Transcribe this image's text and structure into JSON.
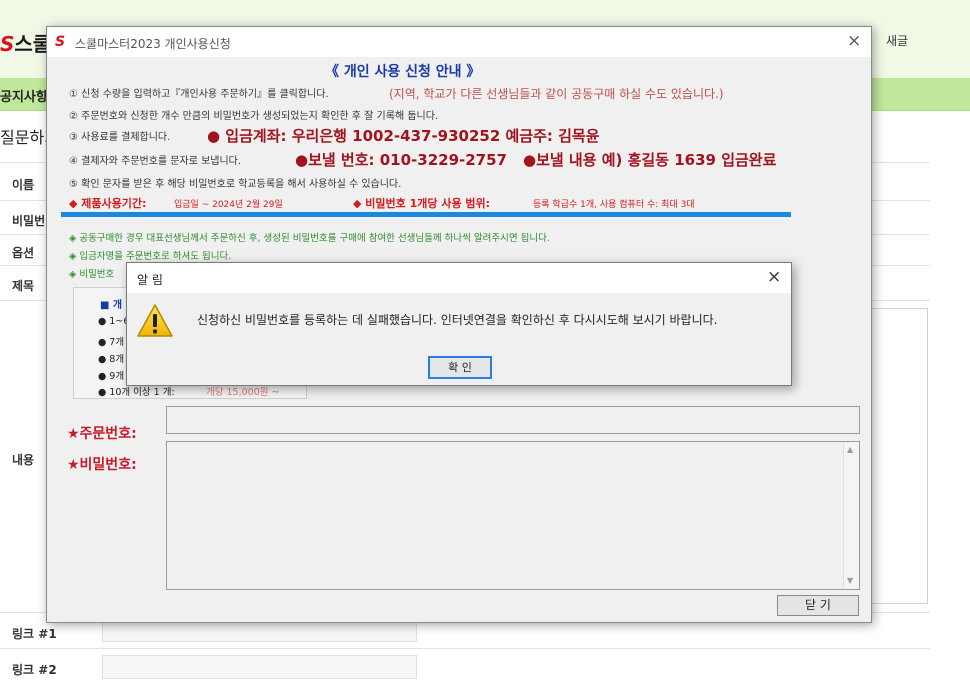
{
  "background": {
    "logo_s": "S",
    "logo_text": "스쿨",
    "new_post": "새글",
    "nav_notice": "공지사항",
    "page_title": "질문하기",
    "labels": {
      "name": "이름",
      "password": "비밀번",
      "option": "옵션",
      "subject": "제목",
      "content": "내용",
      "link1": "링크 #1",
      "link2": "링크 #2"
    }
  },
  "dialog": {
    "icon": "S",
    "title": "스쿨마스터2023 개인사용신청",
    "close": "×",
    "guide_title": "《 개인 사용 신청 안내 》",
    "steps": [
      "① 신청 수량을 입력하고『개인사용 주문하기』를 클릭합니다.",
      "② 주문번호와 신청한 개수 만큼의 비밀번호가 생성되었는지 확인한 후 잘 기록해 둡니다.",
      "③ 사용료를 결제합니다.",
      "④ 결제자와 주문번호를 문자로 보냅니다.",
      "⑤ 확인 문자를 받은 후 해당 비밀번호로 학교등록을 해서 사용하실 수 있습니다."
    ],
    "step_note": "(지역, 학교가 다른 선생님들과 같이 공동구매 하실 수도 있습니다.)",
    "bank_info": "● 입금계좌: 우리은행 1002-437-930252  예금주: 김목윤",
    "send_number": "●보낼 번호: 010-3229-2757",
    "send_content": "●보낼 내용 예) 홍길동 1639 입금완료",
    "period_label": "◆ 제품사용기간:",
    "period_value": "입금일 ~ 2024년 2월 29일",
    "scope_label": "◆ 비밀번호 1개당 사용 범위:",
    "scope_value": "등록 학급수 1개, 사용 컴퓨터 수: 최대 3대",
    "green_notes": [
      "◈ 공동구매한 경우 대표선생님께서 주문하신 후, 생성된 비밀번호를 구매에 참여한 선생님들께 하나씩 알려주시면 됩니다.",
      "◈ 입금자명을 주문번호로 하셔도 됩니다.",
      "◈ 비밀번호"
    ],
    "price_title": "■ 개",
    "price_items": [
      "● 1~6",
      "● 7개",
      "● 8개",
      "● 9개",
      "● 10개 이상 1 개:"
    ],
    "price_tail": "개당 15,000원 ~",
    "order_label": "★주문번호:",
    "password_label": "★비밀번호:",
    "close_button": "닫 기"
  },
  "alert": {
    "title": "알 림",
    "close": "×",
    "message": "신청하신 비밀번호를 등록하는 데 실패했습니다. 인터넷연결을 확인하신 후 다시시도해 보시기 바랍니다.",
    "ok_button": "확 인"
  },
  "colors": {
    "header_bg": "#f1f8e6",
    "nav_bg": "#bfe89a",
    "title_blue": "#1a3aa8",
    "dark_red": "#a0141e",
    "red": "#d41b1b",
    "green": "#2e8b2e",
    "bar_blue": "#1a8ae0",
    "ok_border": "#2a7de1"
  }
}
